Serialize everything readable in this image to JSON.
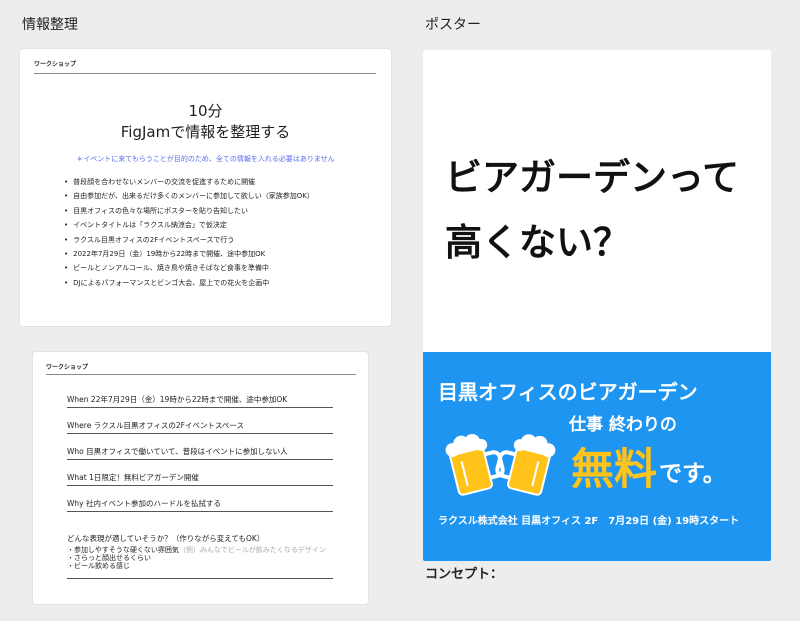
{
  "labels": {
    "info": "情報整理",
    "poster": "ポスター",
    "concept": "コンセプト："
  },
  "card1": {
    "workshop": "ワークショップ",
    "title_line1": "10分",
    "title_line2": "FigJamで情報を整理する",
    "note": "＊イベントに来てもらうことが目的のため、全ての情報を入れる必要はありません",
    "bullets": [
      "普段顔を合わせないメンバーの交流を促進するために開催",
      "自由参加だが、出来るだけ多くのメンバーに参加して欲しい（家族参加OK）",
      "目黒オフィスの色々な場所にポスターを貼り告知したい",
      "イベントタイトルは「ラクスル納涼会」で仮決定",
      "ラクスル目黒オフィスの2Fイベントスペースで行う",
      "2022年7月29日（金）19時から22時まで開催、途中参加OK",
      "ビールとノンアルコール、焼き鳥や焼きそばなど食事を準備中",
      "DJによるパフォーマンスとビンゴ大会、屋上での花火を企画中"
    ]
  },
  "card2": {
    "workshop": "ワークショップ",
    "rows": [
      "When 22年7月29日（金）19時から22時まで開催、途中参加OK",
      "Where ラクスル目黒オフィスの2Fイベントスペース",
      "Who 目黒オフィスで働いていて、普段はイベントに参加しない人",
      "What 1日限定！無料ビアガーデン開催",
      "Why 社内イベント参加のハードルを払拭する"
    ],
    "question": "どんな表現が適していそうか？（作りながら変えてもOK）",
    "option1": "・参加しやすそうな硬くない雰囲気",
    "option1_example": "（例）みんなでビールが飲みたくなるデザイン",
    "option2": "・さらっと顔出せるくらい",
    "option3": "・ビール飲める感じ"
  },
  "poster": {
    "headline_line1": "ビアガーデンって",
    "headline_line2": "高くない？",
    "office": "目黒オフィスのビアガーデン",
    "after_work": "仕事 終わりの",
    "free": "無料",
    "desu": "です。",
    "footer": "ラクスル株式会社 目黒オフィス 2F　7月29日 (金) 19時スタート",
    "blue_color": "#1e95f0",
    "accent_color": "#ffc31a"
  }
}
